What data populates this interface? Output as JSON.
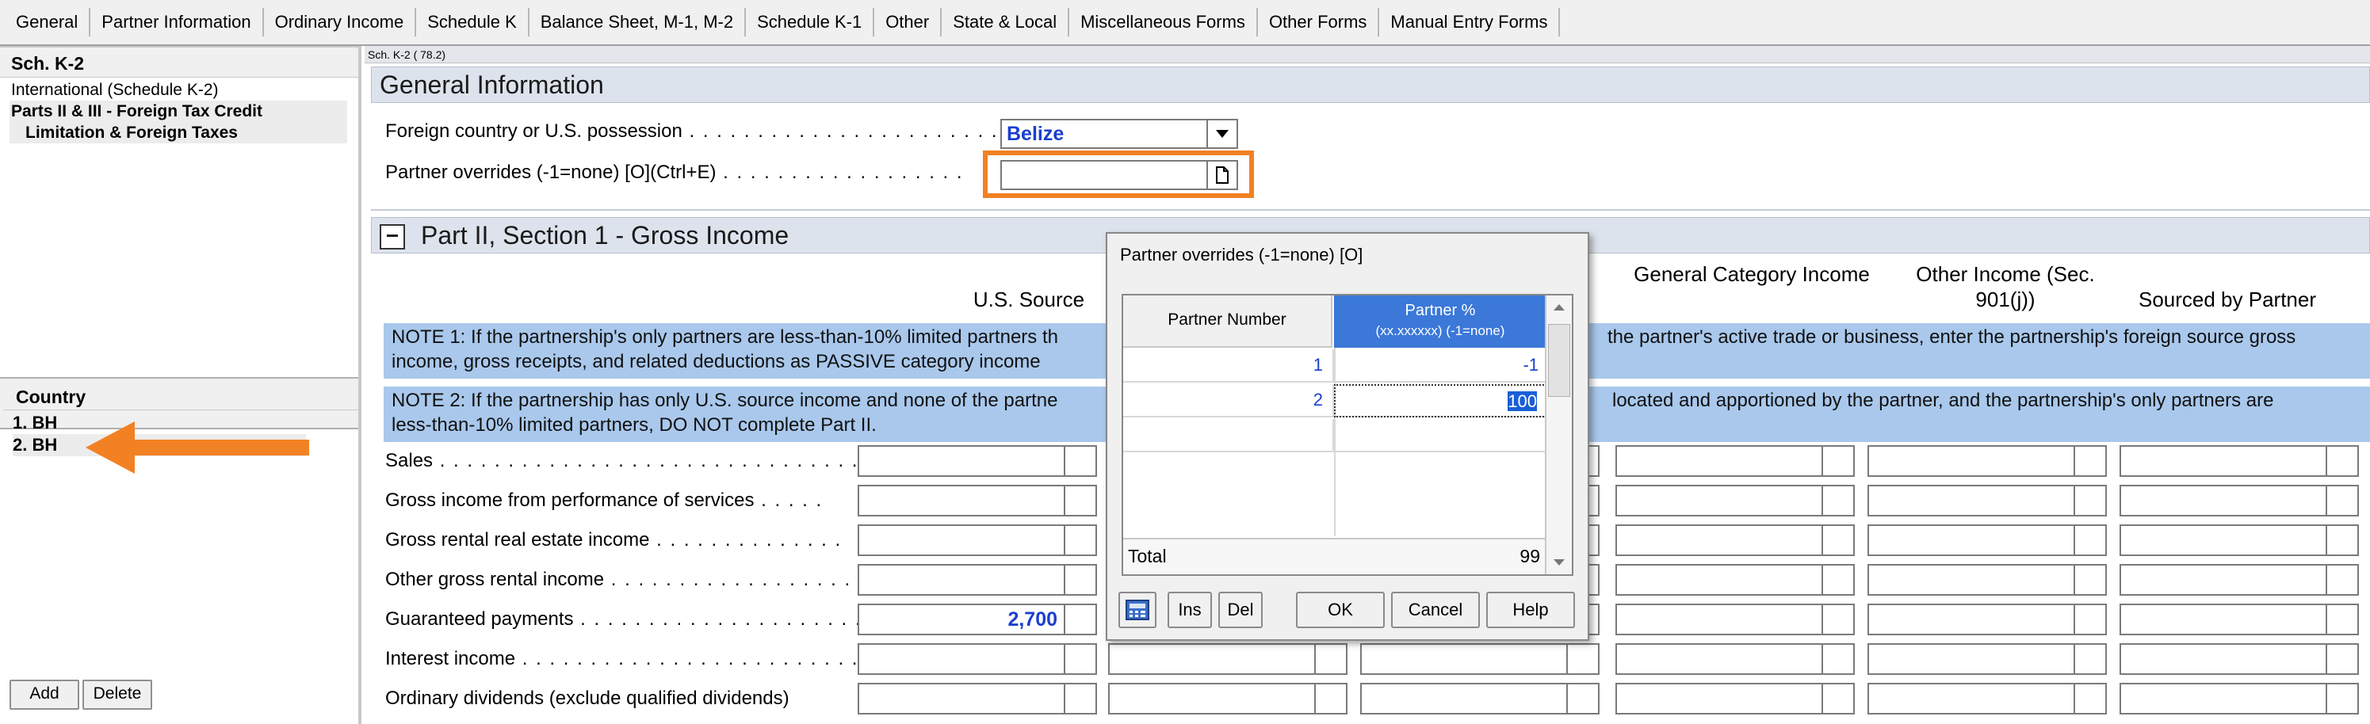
{
  "tabs": [
    "General",
    "Partner Information",
    "Ordinary Income",
    "Schedule K",
    "Balance Sheet, M-1, M-2",
    "Schedule K-1",
    "Other",
    "State & Local",
    "Miscellaneous Forms",
    "Other Forms",
    "Manual Entry Forms"
  ],
  "left": {
    "title": "Sch. K-2",
    "tree": [
      "International (Schedule K-2)",
      "Parts II & III - Foreign Tax Credit",
      "Limitation & Foreign Taxes"
    ],
    "country_title": "Country",
    "countries": [
      "1. BH",
      "2. BH"
    ],
    "add_label": "Add",
    "delete_label": "Delete"
  },
  "main": {
    "sch_label": "Sch. K-2  ( 78.2)",
    "general_info_title": "General Information",
    "foreign_country_label": "Foreign country or U.S. possession",
    "foreign_country_value": "Belize",
    "partner_overrides_label": "Partner overrides (-1=none) [O](Ctrl+E)",
    "part2_title": "Part II, Section 1 - Gross Income",
    "col_us_source": "U.S. Source",
    "col_general_category": "General Category Income",
    "col_other_income": "Other Income (Sec. 901(j))",
    "col_sourced_by_partner": "Sourced by Partner",
    "note1": "NOTE 1: If the partnership's only partners are less-than-10% limited partners that, regarding the partnership, the partnership's activities are not the partner's active trade or business, enter the partnership's foreign source gross income, gross receipts, and related deductions as PASSIVE category income.",
    "note1_visible_a": "NOTE 1: If the partnership's only partners are less-than-10% limited partners th",
    "note1_visible_b": "the partner's active trade or business, enter the partnership's foreign source gross",
    "note1_visible_c": "income, gross receipts, and related deductions as PASSIVE category income",
    "note2_visible_a": "NOTE 2: If the partnership has only U.S. source income and none of the partne",
    "note2_visible_b": "located and apportioned by the partner, and the partnership's only partners are",
    "note2_visible_c": "less-than-10% limited partners, DO NOT complete Part II.",
    "rows": [
      {
        "label": "Sales",
        "us_source": ""
      },
      {
        "label": "Gross income from performance of services",
        "us_source": ""
      },
      {
        "label": "Gross rental real estate income",
        "us_source": ""
      },
      {
        "label": "Other gross rental income",
        "us_source": ""
      },
      {
        "label": "Guaranteed payments",
        "us_source": "2,700"
      },
      {
        "label": "Interest income",
        "us_source": ""
      },
      {
        "label": "Ordinary dividends (exclude qualified dividends)",
        "us_source": ""
      }
    ]
  },
  "dialog": {
    "title": "Partner overrides (-1=none) [O]",
    "col_partner_number": "Partner Number",
    "col_partner_pct": "Partner %",
    "col_partner_pct_sub": "(xx.xxxxxx) (-1=none)",
    "rows": [
      {
        "number": "1",
        "pct": "-1"
      },
      {
        "number": "2",
        "pct": "100"
      }
    ],
    "total_label": "Total",
    "total_value": "99",
    "ins_label": "Ins",
    "del_label": "Del",
    "ok_label": "OK",
    "cancel_label": "Cancel",
    "help_label": "Help"
  },
  "colors": {
    "accent_orange": "#f28123",
    "note_blue": "#a9c8ec",
    "value_blue": "#1a3fcf",
    "grid_header_blue": "#3b78d8"
  }
}
